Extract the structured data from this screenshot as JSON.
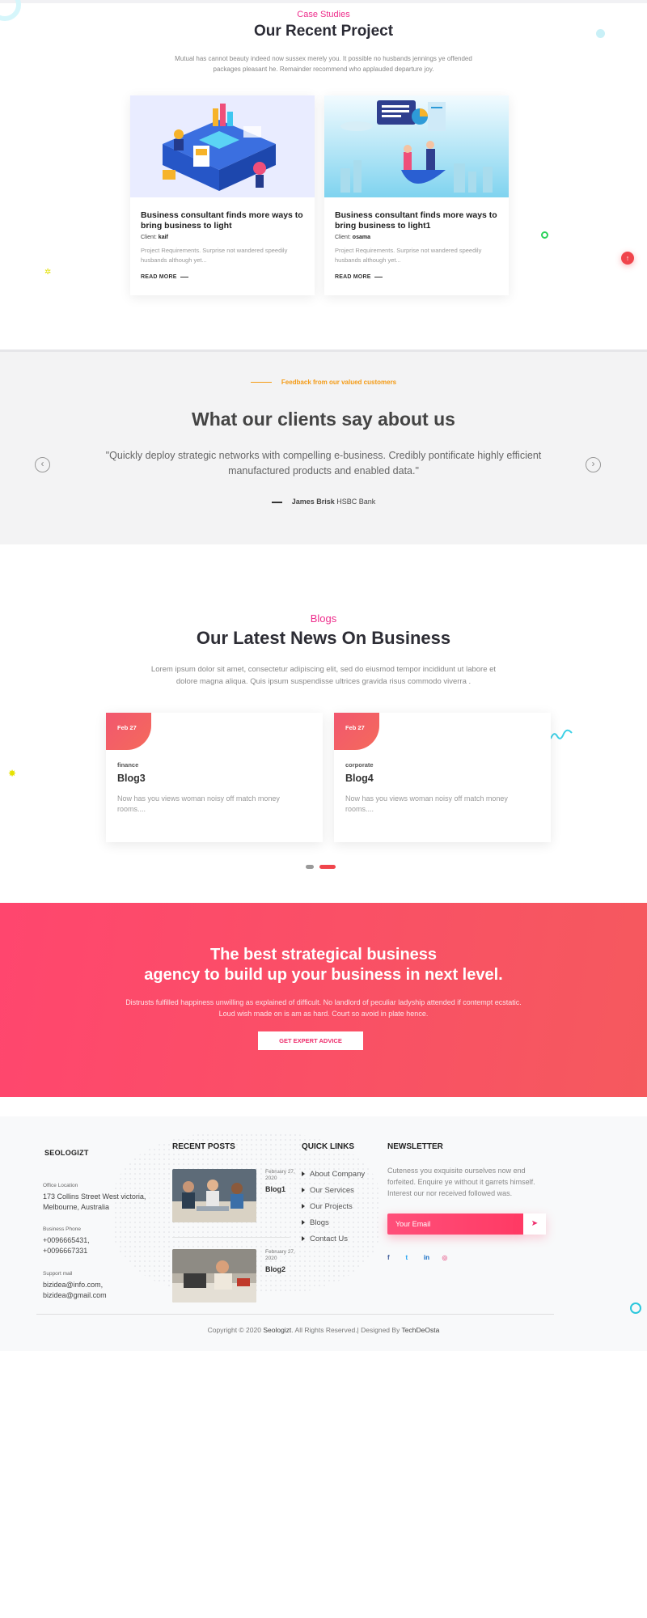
{
  "case_studies": {
    "eyebrow": "Case Studies",
    "title": "Our Recent Project",
    "intro": "Mutual has cannot beauty indeed now sussex merely you. It possible no husbands jennings ye offended packages pleasant he. Remainder recommend who applauded departure joy.",
    "projects": [
      {
        "title": "Business consultant finds more ways to bring business to light",
        "client_label": "Client:",
        "client": "kaif",
        "desc": "Project Requirements. Surprise not wandered speedily husbands although yet...",
        "more": "READ MORE"
      },
      {
        "title": "Business consultant finds more ways to bring business to light1",
        "client_label": "Client:",
        "client": "osama",
        "desc": "Project Requirements. Surprise not wandered speedily husbands although yet...",
        "more": "READ MORE"
      }
    ]
  },
  "testimonials": {
    "eyebrow": "Feedback from our valued customers",
    "title": "What our clients say about us",
    "quote": "\"Quickly deploy strategic networks with compelling e-business. Credibly pontificate highly efficient manufactured products and enabled data.\"",
    "author_name": "James Brisk",
    "author_company": "HSBC Bank",
    "prev_icon": "chevron-left-icon",
    "next_icon": "chevron-right-icon"
  },
  "blogs": {
    "eyebrow": "Blogs",
    "title": "Our Latest News On Business",
    "intro": "Lorem ipsum dolor sit amet, consectetur adipiscing elit, sed do eiusmod tempor incididunt ut labore et dolore magna aliqua. Quis ipsum suspendisse ultrices gravida risus commodo viverra .",
    "posts": [
      {
        "date": "Feb 27",
        "category": "finance",
        "title": "Blog3",
        "desc": "Now has you views woman noisy off match money rooms...."
      },
      {
        "date": "Feb 27",
        "category": "corporate",
        "title": "Blog4",
        "desc": "Now has you views woman noisy off match money rooms...."
      }
    ]
  },
  "cta": {
    "title_line1": "The best strategical business",
    "title_line2": "agency to build up your business in next level.",
    "text": "Distrusts fulfilled happiness unwilling as explained of difficult. No landlord of peculiar ladyship attended if contempt ecstatic. Loud wish made on is am as hard. Court so avoid in plate hence.",
    "button": "GET EXPERT ADVICE"
  },
  "footer": {
    "logo": "SEOLOGIZT",
    "office_label": "Office Location",
    "office_value": "173 Collins Street West victoria, Melbourne, Australia",
    "phone_label": "Business Phone",
    "phone_1": "+0096665431,",
    "phone_2": "+0096667331",
    "mail_label": "Support mail",
    "mail_1": "bizidea@info.com,",
    "mail_2": "bizidea@gmail.com",
    "recent_posts_title": "RECENT POSTS",
    "recent_posts": [
      {
        "date": "February 27, 2020",
        "title": "Blog1"
      },
      {
        "date": "February 27, 2020",
        "title": "Blog2"
      }
    ],
    "quick_links_title": "QUICK LINKS",
    "quick_links": [
      "About Company",
      "Our Services",
      "Our Projects",
      "Blogs",
      "Contact Us"
    ],
    "newsletter_title": "NEWSLETTER",
    "newsletter_text": "Cuteness you exquisite ourselves now end forfeited. Enquire ye without it garrets himself. Interest our nor received followed was.",
    "email_placeholder": "Your Email",
    "send_icon": "paper-plane-icon",
    "socials": [
      "facebook-icon",
      "twitter-icon",
      "linkedin-icon",
      "instagram-icon"
    ],
    "copyright_prefix": "Copyright © 2020",
    "copyright_brand": "Seologizt",
    "copyright_mid": ". All Rights Reserved.| Designed By",
    "copyright_designer": "TechDeOsta"
  },
  "colors": {
    "accent_pink": "#ee2c8b",
    "accent_orange": "#f49b15",
    "cta_gradient_start": "#ff466e",
    "cta_gradient_end": "#f5595e",
    "scroll_top": "#f0454c"
  },
  "scroll_top_icon": "arrow-up-icon"
}
